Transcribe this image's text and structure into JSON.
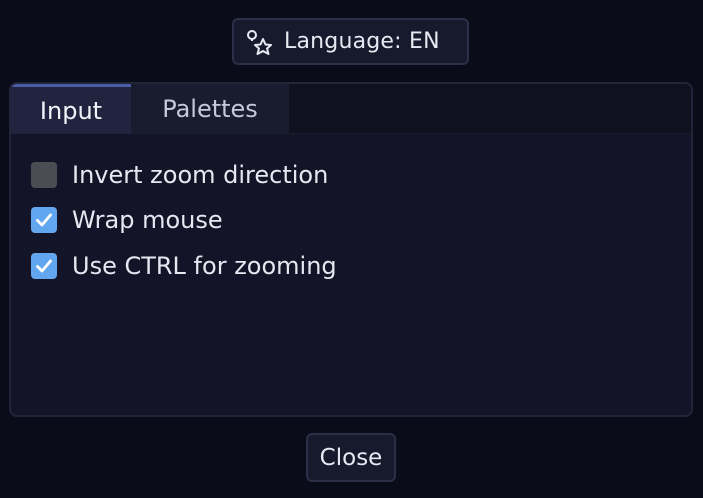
{
  "language_button": {
    "label": "Language: EN",
    "icon": "translate-icon"
  },
  "tabs": [
    {
      "label": "Input",
      "active": true
    },
    {
      "label": "Palettes",
      "active": false
    }
  ],
  "options": [
    {
      "label": "Invert zoom direction",
      "checked": false
    },
    {
      "label": "Wrap mouse",
      "checked": true
    },
    {
      "label": "Use CTRL for zooming",
      "checked": true
    }
  ],
  "close_button": {
    "label": "Close"
  },
  "colors": {
    "background": "#0b0c19",
    "panel": "#131427",
    "accent": "#61a6ee",
    "tab_active": "#20243f",
    "checkbox_unchecked": "#4b4d55"
  }
}
